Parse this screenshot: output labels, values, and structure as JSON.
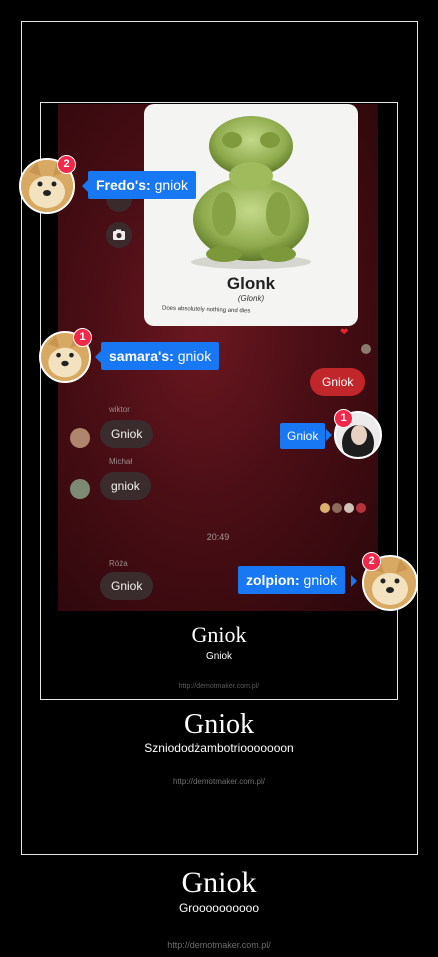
{
  "screenshot": {
    "card": {
      "title": "Glonk",
      "subtitle": "(Glonk)",
      "description": "Does absolutely nothing and dies"
    },
    "labels": [
      {
        "user": "Fredo's:",
        "text": "gniok",
        "badge": "2"
      },
      {
        "user": "samara's:",
        "text": "gniok",
        "badge": "1"
      },
      {
        "user": "",
        "text": "Gniok",
        "badge": "1"
      },
      {
        "user": "zolpion:",
        "text": "gniok",
        "badge": "2"
      }
    ],
    "messages": {
      "outgoing": "Gniok",
      "wiktor_name": "wiktor",
      "wiktor_text": "Gniok",
      "michal_name": "Michał",
      "michal_text": "gniok",
      "time": "20:49",
      "roza_name": "Róża",
      "roza_text": "Gniok"
    }
  },
  "inner_caption": {
    "title": "Gniok",
    "subtitle": "Gniok",
    "url": "http://demotmaker.com.pl/"
  },
  "middle_caption": {
    "title": "Gniok",
    "subtitle": "Szniododżambotriooooooon",
    "url": "http://demotmaker.com.pl/"
  },
  "outer_caption": {
    "title": "Gniok",
    "subtitle": "Groooooooooo",
    "url": "http://demotmaker.com.pl/"
  },
  "colors": {
    "fb_blue": "#1877f2",
    "badge_red": "#f02849",
    "bubble_red": "#c0262a"
  }
}
